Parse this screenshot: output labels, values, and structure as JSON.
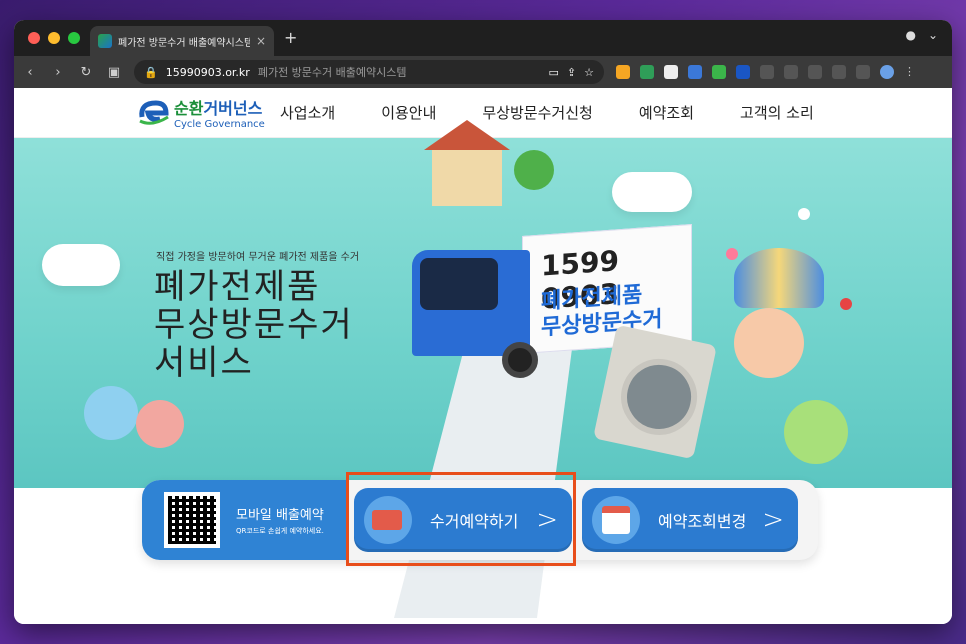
{
  "browser": {
    "tab_title": "폐가전 방문수거 배출예약시스템",
    "tab_close": "×",
    "new_tab": "+",
    "url_domain": "15990903.or.kr",
    "url_page_title": "폐가전 방문수거 배출예약시스템",
    "colors": {
      "frame": "#1f1f1f",
      "toolbar": "#3a3a3a"
    }
  },
  "site": {
    "logo_ko_a": "순환",
    "logo_ko_b": "거버넌스",
    "logo_en": "Cycle Governance",
    "menu": [
      "사업소개",
      "이용안내",
      "무상방문수거신청",
      "예약조회",
      "고객의 소리"
    ]
  },
  "hero": {
    "subtitle": "직접 가정을 방문하여 무거운 폐가전 제품을 수거",
    "title_lines": [
      "폐가전제품",
      "무상방문수거",
      "서비스"
    ],
    "truck_phone": "1599 0903",
    "truck_line1": "폐가전제품",
    "truck_line2": "무상방문수거"
  },
  "cta": {
    "mobile_title": "모바일 배출예약",
    "mobile_sub": "QR코드로 손쉽게 예약하세요.",
    "reserve_label": "수거예약하기",
    "check_label": "예약조회변경",
    "chevron": ">",
    "highlight_color": "#e84e1b",
    "button_color": "#2c7bd0"
  }
}
